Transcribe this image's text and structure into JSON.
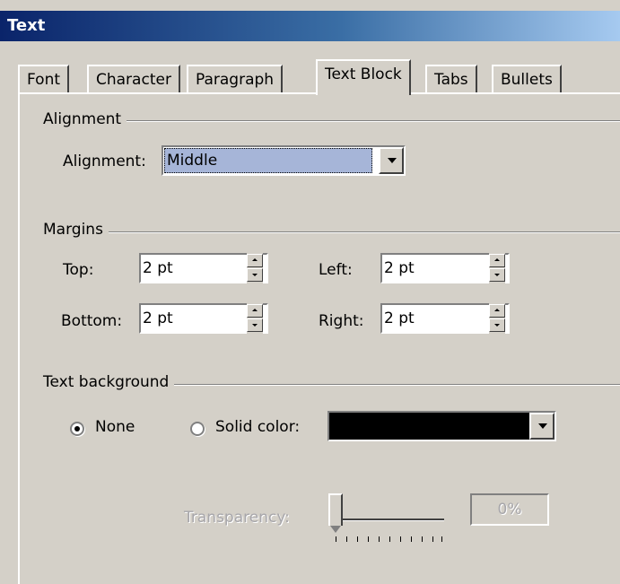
{
  "window": {
    "title": "Text"
  },
  "tabs": [
    {
      "label": "Font",
      "active": false
    },
    {
      "label": "Character",
      "active": false
    },
    {
      "label": "Paragraph",
      "active": false
    },
    {
      "label": "Text Block",
      "active": true
    },
    {
      "label": "Tabs",
      "active": false
    },
    {
      "label": "Bullets",
      "active": false
    }
  ],
  "alignment_group": {
    "title": "Alignment",
    "label": "Alignment:",
    "value": "Middle"
  },
  "margins_group": {
    "title": "Margins",
    "top_label": "Top:",
    "top_value": "2 pt",
    "bottom_label": "Bottom:",
    "bottom_value": "2 pt",
    "left_label": "Left:",
    "left_value": "2 pt",
    "right_label": "Right:",
    "right_value": "2 pt"
  },
  "background_group": {
    "title": "Text background",
    "none_label": "None",
    "none_selected": true,
    "solid_label": "Solid color:",
    "solid_color": "#000000",
    "transparency_label": "Transparency:",
    "transparency_value": "0%",
    "transparency_fraction": 0
  },
  "colors": {
    "dialog_bg": "#d4d0c8",
    "title_gradient_start": "#0a246a",
    "selection_bg": "#a6b5d8"
  }
}
